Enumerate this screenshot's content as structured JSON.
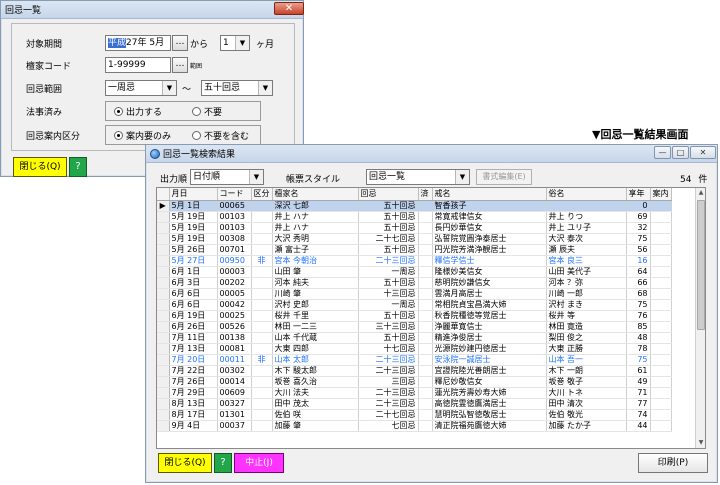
{
  "search_window": {
    "title": "回忌一覧",
    "fields": {
      "period_label": "対象期間",
      "period_era": "平成",
      "period_year": "27年",
      "period_month": "5月",
      "period_from": "から",
      "period_count": "1",
      "period_unit": "ヶ月",
      "family_code_label": "檀家コード",
      "family_code_value": "1-99999",
      "family_code_suffix": "範囲",
      "kaiki_range_label": "回忌範囲",
      "kaiki_from": "一周忌",
      "kaiki_tilde": "～",
      "kaiki_to": "五十回忌",
      "done_label": "法事済み",
      "done_opt1": "出力する",
      "done_opt2": "不要",
      "notice_label": "回忌案内区分",
      "notice_opt1": "案内要のみ",
      "notice_opt2": "不要を含む"
    },
    "buttons": {
      "close": "閉じる(Q)",
      "help": "?"
    }
  },
  "caption": "▼回忌一覧結果画面",
  "results_window": {
    "title": "回忌一覧検索結果",
    "toolbar": {
      "order_label": "出力順",
      "order_value": "日付順",
      "style_label": "帳票スタイル",
      "style_value": "回忌一覧",
      "edit_button": "書式編集(E)",
      "count": "54",
      "count_unit": "件"
    },
    "columns": [
      "",
      "月日",
      "コード",
      "区分",
      "檀家名",
      "回忌",
      "済",
      "戒名",
      "俗名",
      "享年",
      "案内"
    ],
    "rows": [
      {
        "date": "5月 1日",
        "code": "00065",
        "kubun": "",
        "name": "深沢 七郎",
        "kaiki": "五十回忌",
        "done": "",
        "kaimyo": "智香孩子",
        "zokumyo": "",
        "age": "0",
        "annai": "",
        "style": "first"
      },
      {
        "date": "5月 19日",
        "code": "00103",
        "kubun": "",
        "name": "井上 ハナ",
        "kaiki": "五十回忌",
        "done": "",
        "kaimyo": "常寛戒律信女",
        "zokumyo": "井上 りつ",
        "age": "69",
        "annai": "",
        "style": ""
      },
      {
        "date": "5月 19日",
        "code": "00103",
        "kubun": "",
        "name": "井上 ハナ",
        "kaiki": "五十回忌",
        "done": "",
        "kaimyo": "長円妙華信女",
        "zokumyo": "井上 ユリ子",
        "age": "32",
        "annai": "",
        "style": ""
      },
      {
        "date": "5月 19日",
        "code": "00308",
        "kubun": "",
        "name": "大沢 秀明",
        "kaiki": "二十七回忌",
        "done": "",
        "kaimyo": "弘誓院覚圓浄泰居士",
        "zokumyo": "大沢 泰次",
        "age": "75",
        "annai": "",
        "style": ""
      },
      {
        "date": "5月 26日",
        "code": "00701",
        "kubun": "",
        "name": "瀬 富士子",
        "kaiki": "五十回忌",
        "done": "",
        "kaimyo": "円光院芳満浄観居士",
        "zokumyo": "瀬 辰夫",
        "age": "56",
        "annai": "",
        "style": ""
      },
      {
        "date": "5月 27日",
        "code": "00950",
        "kubun": "非",
        "name": "宮本 今朝治",
        "kaiki": "二十三回忌",
        "done": "",
        "kaimyo": "釋信学信士",
        "zokumyo": "宮本 良三",
        "age": "16",
        "annai": "",
        "style": "blue"
      },
      {
        "date": "6月 1日",
        "code": "00003",
        "kubun": "",
        "name": "山田 肇",
        "kaiki": "一周忌",
        "done": "",
        "kaimyo": "隆様妙美信女",
        "zokumyo": "山田 美代子",
        "age": "64",
        "annai": "",
        "style": ""
      },
      {
        "date": "6月 3日",
        "code": "00202",
        "kubun": "",
        "name": "河本 純夫",
        "kaiki": "五十回忌",
        "done": "",
        "kaimyo": "慈明院妙謙信女",
        "zokumyo": "河本 ？弥",
        "age": "66",
        "annai": "",
        "style": ""
      },
      {
        "date": "6月 6日",
        "code": "00005",
        "kubun": "",
        "name": "川崎 肇",
        "kaiki": "十三回忌",
        "done": "",
        "kaimyo": "雲満月高居士",
        "zokumyo": "川崎 一郎",
        "age": "68",
        "annai": "",
        "style": ""
      },
      {
        "date": "6月 6日",
        "code": "00042",
        "kubun": "",
        "name": "沢村 史郎",
        "kaiki": "一周忌",
        "done": "",
        "kaimyo": "常相院貞宝昌満大姉",
        "zokumyo": "沢村 まき",
        "age": "75",
        "annai": "",
        "style": ""
      },
      {
        "date": "6月 19日",
        "code": "00025",
        "kubun": "",
        "name": "桜井 千里",
        "kaiki": "五十回忌",
        "done": "",
        "kaimyo": "秋香院種徳等覚居士",
        "zokumyo": "桜井 等",
        "age": "76",
        "annai": "",
        "style": ""
      },
      {
        "date": "6月 26日",
        "code": "00526",
        "kubun": "",
        "name": "林田 一二三",
        "kaiki": "三十三回忌",
        "done": "",
        "kaimyo": "浄麗華寛信士",
        "zokumyo": "林田 寛造",
        "age": "85",
        "annai": "",
        "style": ""
      },
      {
        "date": "7月 11日",
        "code": "00138",
        "kubun": "",
        "name": "山本 千代蔵",
        "kaiki": "五十回忌",
        "done": "",
        "kaimyo": "精進浄俊居士",
        "zokumyo": "梨田 俊之",
        "age": "48",
        "annai": "",
        "style": ""
      },
      {
        "date": "7月 13日",
        "code": "00081",
        "kubun": "",
        "name": "大東 四郎",
        "kaiki": "十七回忌",
        "done": "",
        "kaimyo": "光源院妙建円徳居士",
        "zokumyo": "大東 正勝",
        "age": "78",
        "annai": "",
        "style": ""
      },
      {
        "date": "7月 20日",
        "code": "00011",
        "kubun": "非",
        "name": "山本 太郎",
        "kaiki": "二十三回忌",
        "done": "",
        "kaimyo": "安泳院一誠居士",
        "zokumyo": "山本 吾一",
        "age": "75",
        "annai": "",
        "style": "blue"
      },
      {
        "date": "7月 22日",
        "code": "00302",
        "kubun": "",
        "name": "木下 駿太郎",
        "kaiki": "二十三回忌",
        "done": "",
        "kaimyo": "宜證院陸光善朗居士",
        "zokumyo": "木下 一朗",
        "age": "61",
        "annai": "",
        "style": ""
      },
      {
        "date": "7月 26日",
        "code": "00014",
        "kubun": "",
        "name": "坂巻 喜久治",
        "kaiki": "三回忌",
        "done": "",
        "kaimyo": "釋尼妙敬信女",
        "zokumyo": "坂巻 敬子",
        "age": "49",
        "annai": "",
        "style": ""
      },
      {
        "date": "7月 29日",
        "code": "00609",
        "kubun": "",
        "name": "大川 法夫",
        "kaiki": "二十三回忌",
        "done": "",
        "kaimyo": "蓮光院芳壽妙寿大姉",
        "zokumyo": "大川 トネ",
        "age": "71",
        "annai": "",
        "style": ""
      },
      {
        "date": "8月 13日",
        "code": "00327",
        "kubun": "",
        "name": "田中 茂太",
        "kaiki": "二十三回忌",
        "done": "",
        "kaimyo": "高徳院霊徳鷹満居士",
        "zokumyo": "田中 清次",
        "age": "77",
        "annai": "",
        "style": ""
      },
      {
        "date": "8月 17日",
        "code": "01301",
        "kubun": "",
        "name": "佐伯 咲",
        "kaiki": "二十七回忌",
        "done": "",
        "kaimyo": "慧明院弘智徳敬居士",
        "zokumyo": "佐伯 敬光",
        "age": "74",
        "annai": "",
        "style": ""
      },
      {
        "date": "9月 4日",
        "code": "00037",
        "kubun": "",
        "name": "加藤 肇",
        "kaiki": "七回忌",
        "done": "",
        "kaimyo": "清正院福苑鷹徳大姉",
        "zokumyo": "加藤 たか子",
        "age": "44",
        "annai": "",
        "style": ""
      }
    ],
    "buttons": {
      "close": "閉じる(Q)",
      "help": "?",
      "stop": "中止(J)",
      "print": "印刷(P)"
    }
  }
}
